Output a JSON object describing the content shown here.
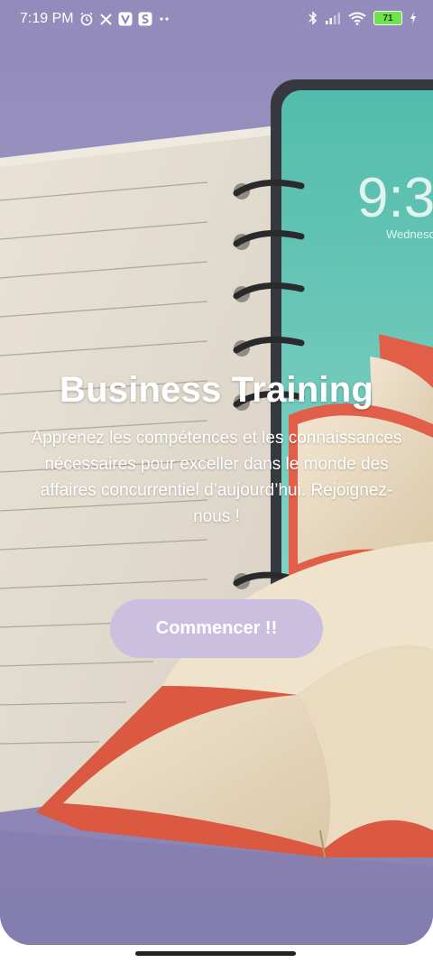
{
  "status_bar": {
    "time": "7:19 PM",
    "battery_level": "71",
    "icons": [
      "alarm-icon",
      "x-logo-icon",
      "v-app-icon",
      "s-app-icon",
      "more-dots-icon",
      "bluetooth-icon",
      "signal-icon",
      "wifi-icon",
      "battery-icon",
      "charging-icon"
    ]
  },
  "background": {
    "clock_text": "9:3",
    "day_text": "Wednesda"
  },
  "hero": {
    "title": "Business Training",
    "subtitle": "Apprenez les compétences et les connaissances nécessaires pour exceller dans le monde des affaires concurrentiel d’aujourd’hui. Rejoignez-nous !"
  },
  "cta": {
    "label": "Commencer !!"
  },
  "colors": {
    "background": "#8f86b6",
    "button": "#cbbfe0",
    "book": "#e0563d",
    "tablet_screen": "#4ab7a8"
  }
}
